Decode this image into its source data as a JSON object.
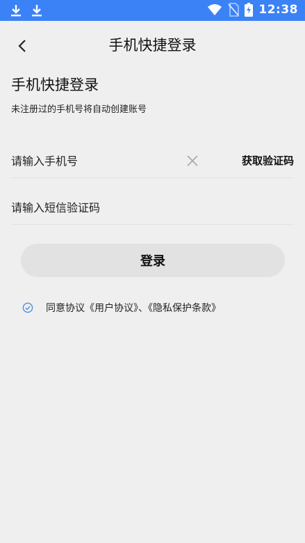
{
  "status_bar": {
    "time": "12:38",
    "icons": [
      "download-icon",
      "download-icon",
      "wifi-icon",
      "no-sim-icon",
      "battery-charging-icon"
    ]
  },
  "header": {
    "title": "手机快捷登录",
    "back_icon": "chevron-left-icon"
  },
  "page": {
    "title": "手机快捷登录",
    "subtitle": "未注册过的手机号将自动创建账号"
  },
  "form": {
    "phone_placeholder": "请输入手机号",
    "phone_value": "",
    "get_code_label": "获取验证码",
    "code_placeholder": "请输入短信验证码",
    "code_value": "",
    "login_label": "登录"
  },
  "agreement": {
    "text": "同意协议《用户协议》、《隐私保护条款》",
    "checked": true
  },
  "colors": {
    "status_bar": "#3b82f6",
    "background": "#efefef",
    "button": "#e2e2e2",
    "check": "#4a90e2"
  }
}
